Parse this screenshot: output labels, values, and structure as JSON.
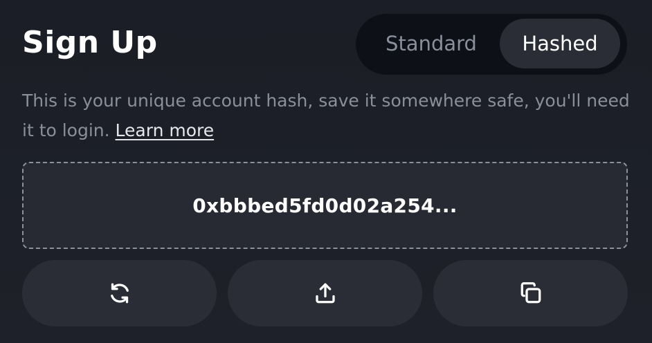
{
  "header": {
    "title": "Sign Up"
  },
  "toggle": {
    "options": [
      {
        "label": "Standard",
        "selected": false
      },
      {
        "label": "Hashed",
        "selected": true
      }
    ]
  },
  "description": {
    "text": "This is your unique account hash, save it somewhere safe, you'll need it to login.",
    "link_label": "Learn more"
  },
  "hash": {
    "value": "0xbbbed5fd0d02a254..."
  },
  "actions": [
    {
      "icon": "refresh-icon"
    },
    {
      "icon": "upload-icon"
    },
    {
      "icon": "copy-icon"
    }
  ],
  "colors": {
    "background": "#1c1f27",
    "toggle_track": "#0d1017",
    "surface": "#2a2d36",
    "muted_text": "#8a8f9a",
    "text": "#ffffff"
  }
}
